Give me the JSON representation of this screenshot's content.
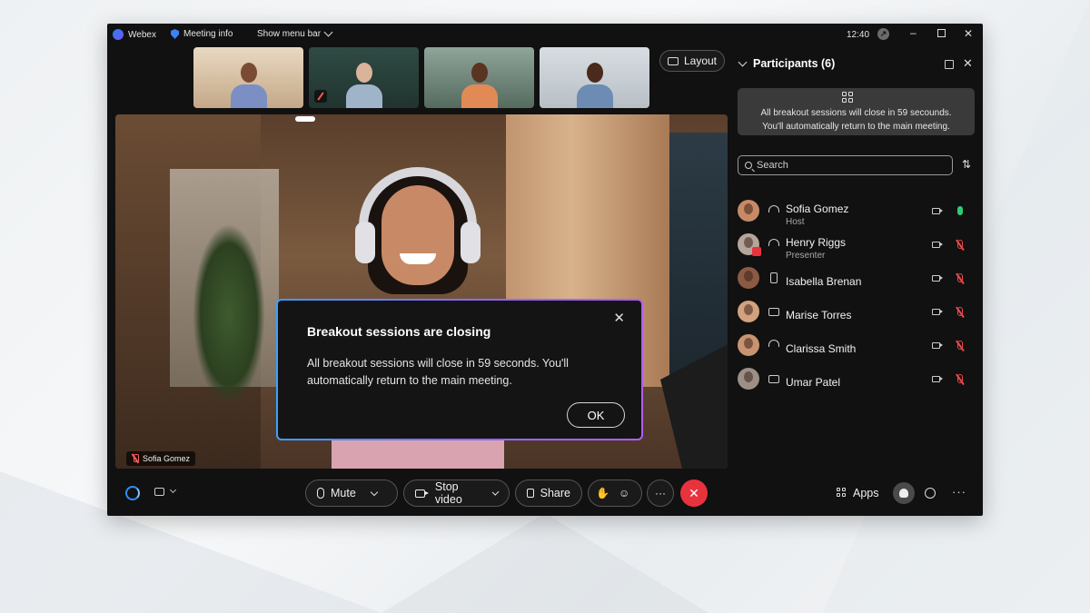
{
  "titlebar": {
    "app_name": "Webex",
    "meeting_info": "Meeting info",
    "show_menu_bar": "Show menu bar",
    "time": "12:40"
  },
  "layout_button": "Layout",
  "stage": {
    "active_speaker_name": "Sofia Gomez"
  },
  "dialog": {
    "title": "Breakout sessions are closing",
    "body": "All breakout sessions will close in 59 seconds. You'll automatically return to the main meeting.",
    "ok_label": "OK",
    "close_icon": "close-icon"
  },
  "controls": {
    "mute_label": "Mute",
    "stop_video_label": "Stop video",
    "share_label": "Share",
    "more_label": "···",
    "end_icon": "✕",
    "apps_label": "Apps"
  },
  "panel": {
    "title": "Participants (6)",
    "notice_line1": "All breakout sessions will close in 59 secounds.",
    "notice_line2": "You'll automatically return to the main meeting.",
    "search_placeholder": "Search",
    "participants": [
      {
        "name": "Sofia Gomez",
        "role": "Host",
        "device": "headset-icon",
        "mic": "on",
        "avatar_color": "#c88a66"
      },
      {
        "name": "Henry Riggs",
        "role": "Presenter",
        "device": "headset-icon",
        "mic": "muted",
        "avatar_color": "#b6a59a",
        "sharing": true
      },
      {
        "name": "Isabella Brenan",
        "role": "",
        "device": "phone-icon",
        "mic": "muted",
        "avatar_color": "#8a5a44"
      },
      {
        "name": "Marise Torres",
        "role": "",
        "device": "laptop-icon",
        "mic": "muted",
        "avatar_color": "#d2a27e"
      },
      {
        "name": "Clarissa Smith",
        "role": "",
        "device": "headset-icon",
        "mic": "muted",
        "avatar_color": "#c89370"
      },
      {
        "name": "Umar Patel",
        "role": "",
        "device": "laptop-icon",
        "mic": "muted",
        "avatar_color": "#9b8f86"
      }
    ]
  },
  "colors": {
    "accent_blue": "#2f8cff",
    "end_call_red": "#e8333d",
    "mic_on_green": "#2ecc71",
    "muted_red": "#e84a4a"
  }
}
